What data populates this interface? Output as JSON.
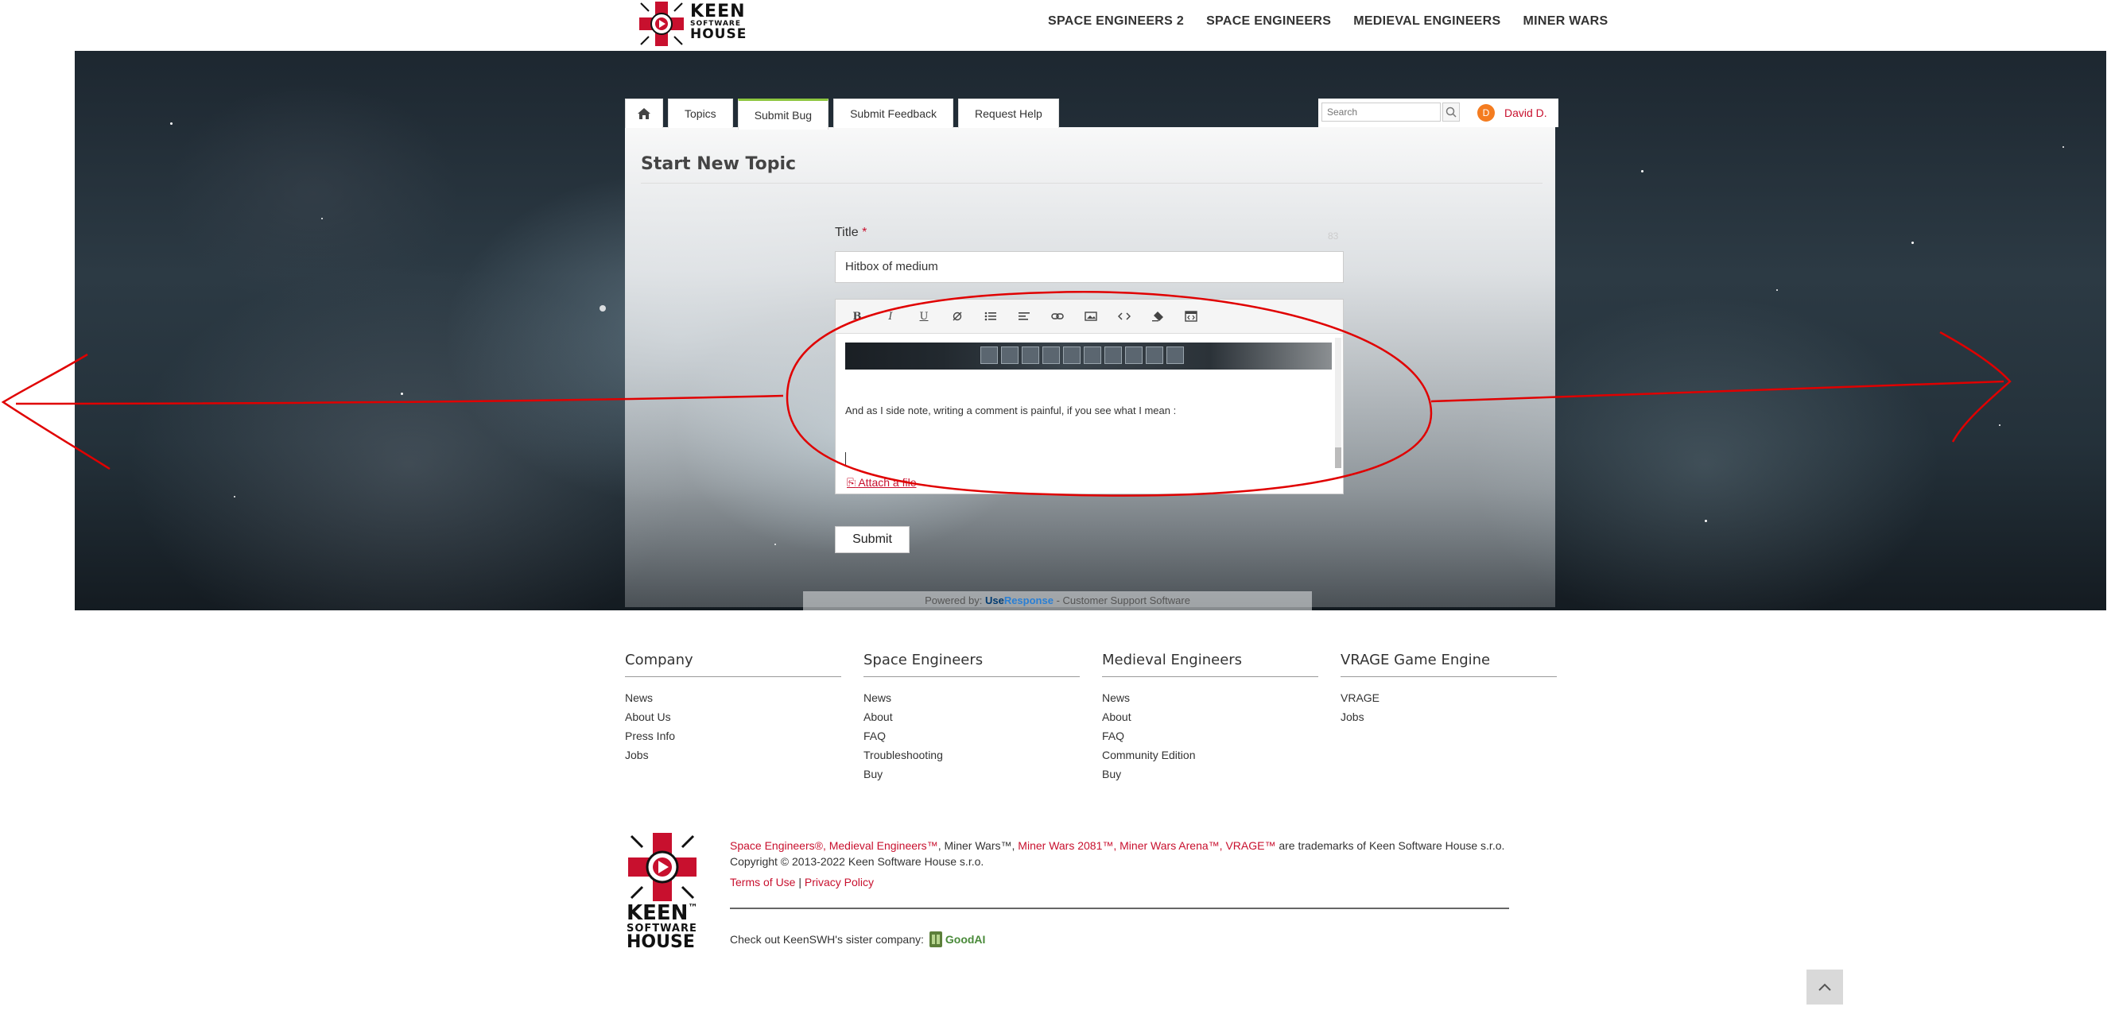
{
  "header": {
    "logo_keen": "KEEN",
    "logo_software": "SOFTWARE",
    "logo_house": "HOUSE",
    "nav": [
      "SPACE ENGINEERS 2",
      "SPACE ENGINEERS",
      "MEDIEVAL ENGINEERS",
      "MINER WARS"
    ]
  },
  "tabs": {
    "home_icon": "home-icon",
    "topics": "Topics",
    "submit_bug": "Submit Bug",
    "submit_feedback": "Submit Feedback",
    "request_help": "Request Help"
  },
  "search": {
    "placeholder": "Search",
    "icon": "search-icon"
  },
  "user": {
    "avatar_letter": "D",
    "name": "David D."
  },
  "form": {
    "page_title": "Start New Topic",
    "title_label": "Title",
    "required_mark": "*",
    "title_counter": "83",
    "title_value": "Hitbox of medium",
    "toolbar": [
      "bold-icon",
      "italic-icon",
      "underline-icon",
      "strikethrough-icon",
      "list-icon",
      "align-icon",
      "link-icon",
      "image-icon",
      "code-icon",
      "eraser-icon",
      "embed-icon"
    ],
    "editor_text": "And as I side note, writing a comment is painful, if you see what I mean :",
    "attach_label": "Attach a file",
    "submit_label": "Submit"
  },
  "powered": {
    "prefix": "Powered by:",
    "brand_use": "Use",
    "brand_response": "Response",
    "suffix": "- Customer Support Software"
  },
  "footer": {
    "columns": [
      {
        "title": "Company",
        "links": [
          "News",
          "About Us",
          "Press Info",
          "Jobs"
        ]
      },
      {
        "title": "Space Engineers",
        "links": [
          "News",
          "About",
          "FAQ",
          "Troubleshooting",
          "Buy"
        ]
      },
      {
        "title": "Medieval Engineers",
        "links": [
          "News",
          "About",
          "FAQ",
          "Community Edition",
          "Buy"
        ]
      },
      {
        "title": "VRAGE Game Engine",
        "links": [
          "VRAGE",
          "Jobs"
        ]
      }
    ],
    "trademark_red_1": "Space Engineers®, Medieval Engineers™",
    "trademark_plain_1": ", Miner Wars™, ",
    "trademark_red_2": "Miner Wars 2081™, Miner Wars Arena™, VRAGE™",
    "trademark_plain_2": " are trademarks of Keen Software House s.r.o.",
    "copyright": "Copyright © 2013-2022 Keen Software House s.r.o.",
    "terms": "Terms of Use",
    "sep": "|",
    "privacy": "Privacy Policy",
    "sister_text": "Check out KeenSWH's sister company:",
    "sister_brand": "GoodAI",
    "logo_keen": "KEEN",
    "logo_tm": "™",
    "logo_software": "SOFTWARE",
    "logo_house": "HOUSE"
  },
  "colors": {
    "accent_red": "#c8102e",
    "tab_active": "#8dc63f",
    "annotation": "#e00000"
  }
}
